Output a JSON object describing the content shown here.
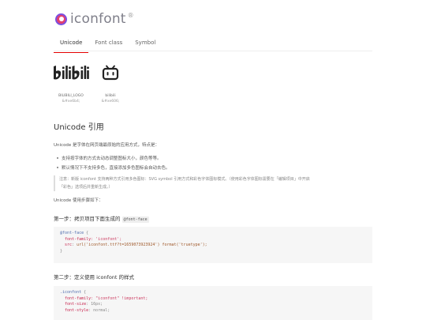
{
  "header": {
    "logo_text": "iconfont",
    "logo_superscript": "®"
  },
  "tabs": [
    {
      "label": "Unicode",
      "active": true
    },
    {
      "label": "Font class",
      "active": false
    },
    {
      "label": "Symbol",
      "active": false
    }
  ],
  "icons": [
    {
      "name": "BILIBILI_LOGO",
      "code": "&#xe6b4;",
      "icon": "bilibili-logo-icon"
    },
    {
      "name": "bilibili",
      "code": "&#xe606;",
      "icon": "bilibili-tv-icon"
    }
  ],
  "section": {
    "title": "Unicode 引用",
    "intro": "Unicode 是字体在网页端最原始的应用方式，特点是：",
    "bullets": [
      "支持按字体的方式去动态调整图标大小，颜色等等。",
      "默认情况下不支持多色，直接添加多色图标会自动去色。"
    ],
    "note": "注意：新版 iconfont 支持两种方式引用多色图标：SVG symbol 引用方式和彩色字体图标模式。（使用彩色字体图标需要在「编辑项目」中开启「彩色」选项后并重新生成。）",
    "usage": "Unicode 使用步骤如下：",
    "step1": {
      "title": "第一步：拷贝项目下面生成的",
      "code_label": "@font-face"
    },
    "step2": {
      "title": "第二步：定义使用 iconfont 的样式"
    }
  },
  "code1": {
    "line1_selector": "@font-face",
    "line1_brace": " {",
    "line2_prop": "font-family",
    "line2_value": ": 'iconfont';",
    "line3_prop": "src",
    "line3_colon": ": ",
    "line3_url": "url('iconfont.ttf?t=1659073923924')",
    "line3_format": " format('truetype');",
    "line4": "}"
  },
  "code2": {
    "line1_selector": ".iconfont",
    "line1_brace": " {",
    "line2_prop": "font-family",
    "line2_value": ": \"iconfont\" !important;",
    "line3_prop": "font-size",
    "line3_value": ": 16px;",
    "line4_prop": "font-style",
    "line4_value": ": normal;"
  }
}
